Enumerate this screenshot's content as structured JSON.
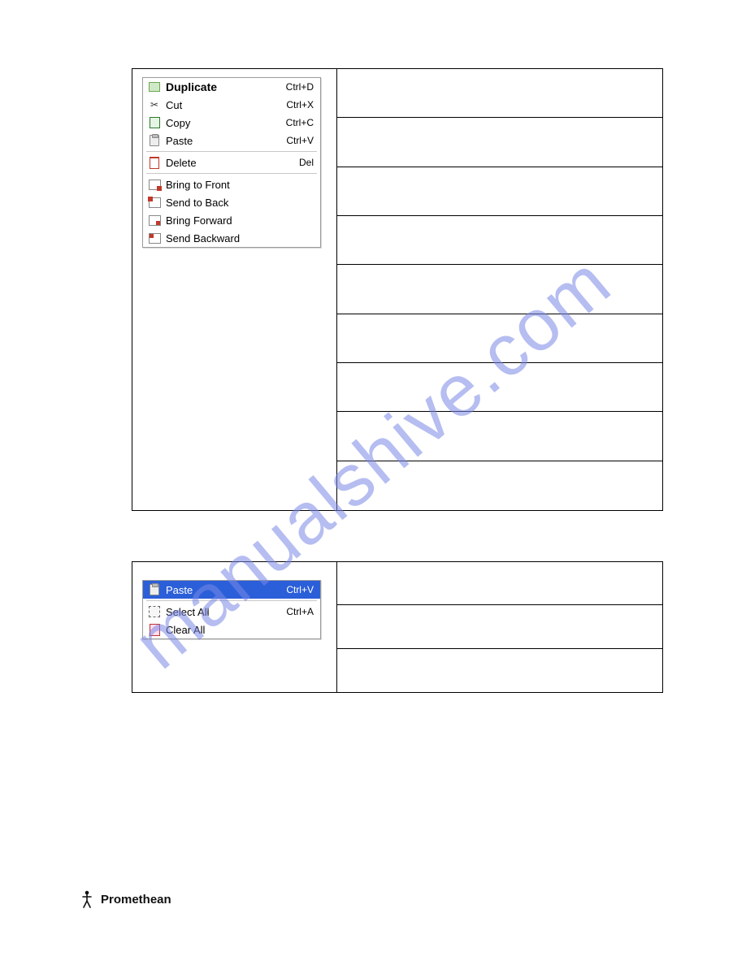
{
  "watermark": "manualshive.com",
  "menu1": {
    "items": [
      {
        "label": "Duplicate",
        "shortcut": "Ctrl+D",
        "bold": true,
        "icon": "duplicate-icon"
      },
      {
        "label": "Cut",
        "shortcut": "Ctrl+X",
        "icon": "cut-icon"
      },
      {
        "label": "Copy",
        "shortcut": "Ctrl+C",
        "icon": "copy-icon"
      },
      {
        "label": "Paste",
        "shortcut": "Ctrl+V",
        "icon": "paste-icon"
      }
    ],
    "items2": [
      {
        "label": "Delete",
        "shortcut": "Del",
        "icon": "trash-icon"
      }
    ],
    "items3": [
      {
        "label": "Bring to Front",
        "shortcut": "",
        "icon": "bring-front-icon"
      },
      {
        "label": "Send to Back",
        "shortcut": "",
        "icon": "send-back-icon"
      },
      {
        "label": "Bring Forward",
        "shortcut": "",
        "icon": "bring-forward-icon"
      },
      {
        "label": "Send Backward",
        "shortcut": "",
        "icon": "send-backward-icon"
      }
    ]
  },
  "menu2": {
    "items": [
      {
        "label": "Paste",
        "shortcut": "Ctrl+V",
        "icon": "paste-icon",
        "selected": true
      },
      {
        "label": "Select All",
        "shortcut": "Ctrl+A",
        "icon": "select-all-icon"
      },
      {
        "label": "Clear All",
        "shortcut": "",
        "icon": "clear-all-icon"
      }
    ]
  },
  "brand": "Promethean"
}
